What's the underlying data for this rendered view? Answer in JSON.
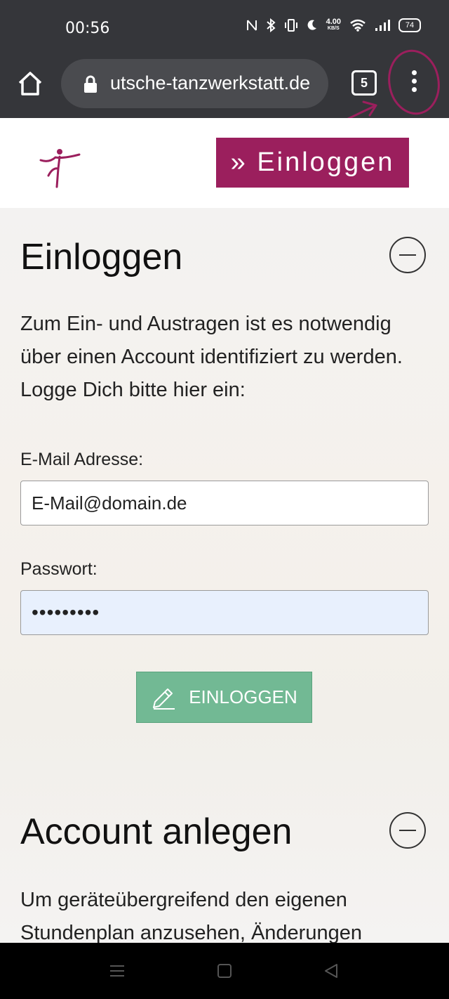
{
  "status_bar": {
    "time": "00:56",
    "net_speed_top": "4.00",
    "net_speed_bottom": "KB/S",
    "battery": "74",
    "icons": [
      "nfc-icon",
      "bluetooth-icon",
      "vibrate-icon",
      "dnd-moon-icon",
      "wifi-icon",
      "signal-icon",
      "battery-icon"
    ]
  },
  "browser": {
    "url": "utsche-tanzwerkstatt.de",
    "tab_count": "5",
    "annotation_color": "#9b1f5d"
  },
  "header": {
    "login_button": "» Einloggen"
  },
  "login_section": {
    "title": "Einloggen",
    "description": "Zum Ein- und Austragen ist es notwendig über einen Account identifiziert zu werden. Logge Dich bitte hier ein:",
    "email_label": "E-Mail Adresse:",
    "email_value": "E-Mail@domain.de",
    "password_label": "Passwort:",
    "password_value": "•••••••••",
    "submit_label": "EINLOGGEN"
  },
  "account_section": {
    "title": "Account anlegen",
    "description": "Um geräteübergreifend den eigenen Stundenplan anzusehen, Änderungen"
  },
  "colors": {
    "brand": "#9b1f5d",
    "button_green": "#72b994",
    "chrome_bar": "#35363a"
  }
}
